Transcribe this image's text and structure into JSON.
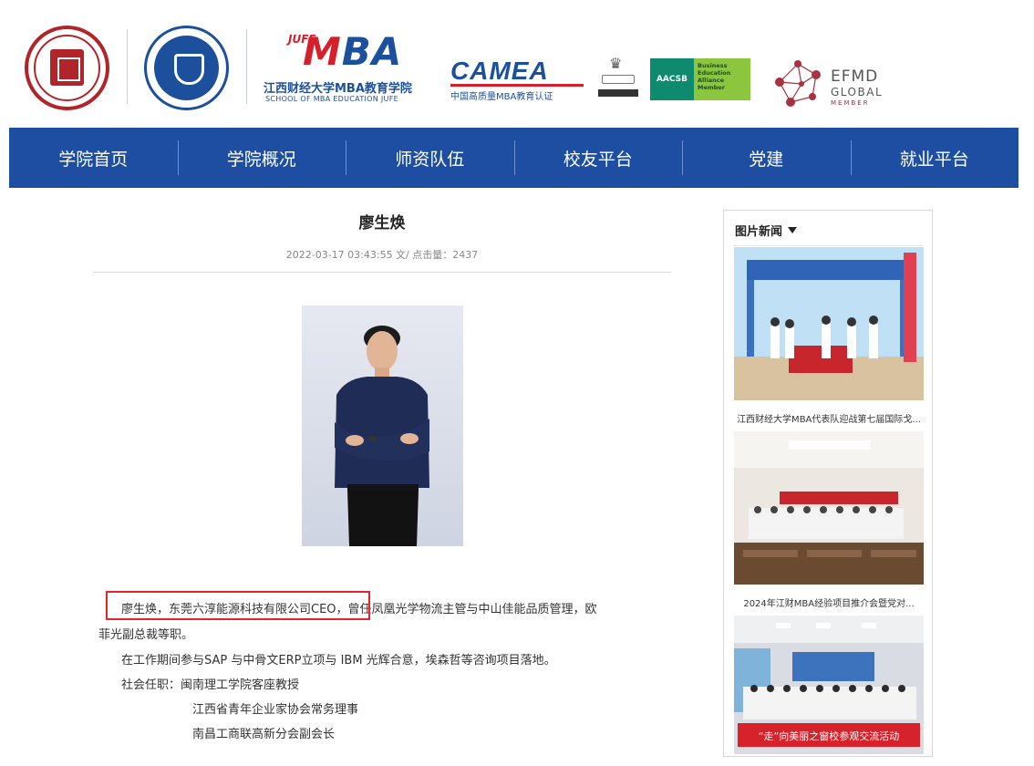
{
  "header": {
    "mba_logo": {
      "tag": "JUFE",
      "word_m": "M",
      "word_ba": "BA",
      "cn": "江西财经大学MBA教育学院",
      "en": "SCHOOL OF MBA EDUCATION JUFE"
    },
    "camea": {
      "word": "CAMEA",
      "sub": "中国高质量MBA教育认证"
    },
    "aacsb": {
      "left": "AACSB",
      "right": "Business Education Alliance Member"
    },
    "efmd": {
      "line1": "EFMD",
      "line2": "GLOBAL",
      "line3": "MEMBER"
    }
  },
  "nav": [
    {
      "label": "学院首页"
    },
    {
      "label": "学院概况"
    },
    {
      "label": "师资队伍"
    },
    {
      "label": "校友平台"
    },
    {
      "label": "党建"
    },
    {
      "label": "就业平台"
    }
  ],
  "article": {
    "title": "廖生焕",
    "meta": "2022-03-17 03:43:55 文/ 点击量：2437",
    "paragraphs": {
      "p1_highlight": "廖生焕，东莞六淳能源科技有限公司CEO，",
      "p1_rest": "曾任凤凰光学物流主管与中山佳能品质管理，欧",
      "p1_line2": "菲光副总裁等职。",
      "p2": "在工作期间参与SAP 与中骨文ERP立项与   IBM 光辉合意，埃森哲等咨询项目落地。",
      "p3": "社会任职：闽南理工学院客座教授",
      "p4": "江西省青年企业家协会常务理事",
      "p5": "南昌工商联高新分会副会长"
    }
  },
  "sidebar": {
    "title": "图片新闻",
    "items": [
      {
        "caption": "江西财经大学MBA代表队迎战第七届国际戈..."
      },
      {
        "caption": "2024年江财MBA经验项目推介会暨党对..."
      },
      {
        "caption": ""
      }
    ],
    "banner_text": "“走”向美丽之窗校参观交流活动"
  },
  "colors": {
    "nav_bg": "#1e4ea1",
    "brand_red": "#d71f2a",
    "brand_blue": "#1c4f9c",
    "highlight_border": "#e3262b"
  }
}
